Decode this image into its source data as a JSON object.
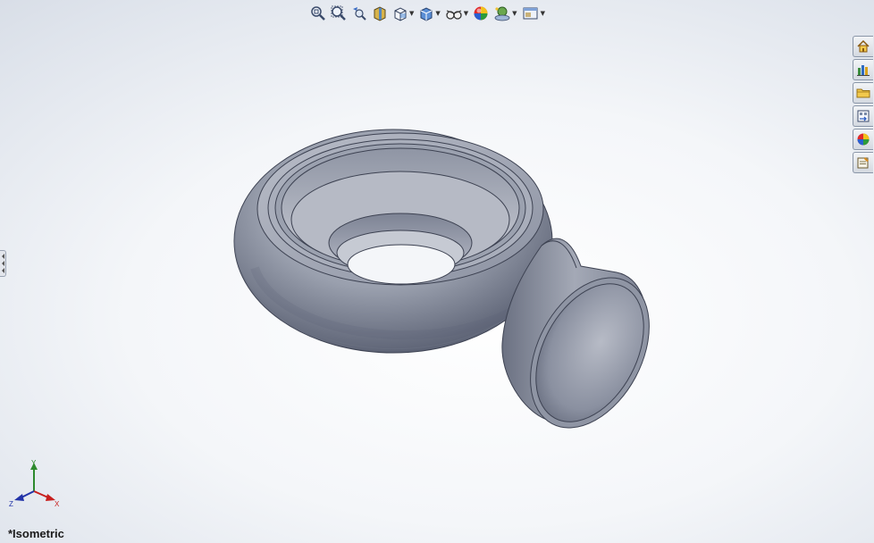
{
  "view": {
    "name": "*Isometric"
  },
  "triad": {
    "x_label": "X",
    "y_label": "Y",
    "z_label": "Z"
  },
  "toolbar": {
    "icons": [
      "zoom-to-fit-icon",
      "zoom-to-area-icon",
      "previous-view-icon",
      "section-view-icon",
      "view-orientation-icon",
      "display-style-icon",
      "hide-show-items-icon",
      "edit-appearance-icon",
      "apply-scene-icon",
      "view-settings-icon"
    ]
  },
  "task_pane": {
    "tabs": [
      "solidworks-resources-icon",
      "design-library-icon",
      "file-explorer-icon",
      "view-palette-icon",
      "appearances-scenes-icon",
      "custom-properties-icon"
    ]
  },
  "colors": {
    "part_body": "#8c93a3",
    "part_dark": "#5b6173",
    "part_light": "#c6cad4",
    "axis_x": "#c8201e",
    "axis_y": "#2d8a2d",
    "axis_z": "#2233a8"
  }
}
